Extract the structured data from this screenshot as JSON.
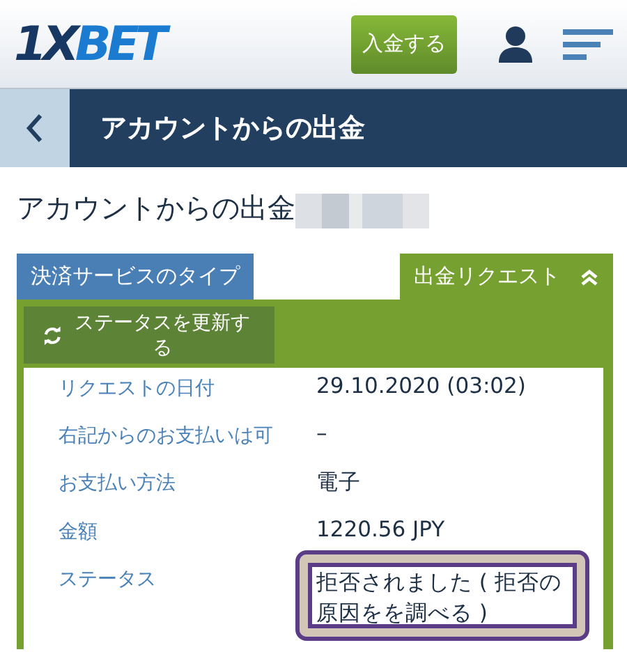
{
  "header": {
    "logo": {
      "prefix": "1X",
      "suffix": "BET"
    },
    "deposit_button": "入金する"
  },
  "nav": {
    "title": "アカウントからの出金"
  },
  "page_title": "アカウントからの出金",
  "tabs": [
    {
      "label": "決済サービスのタイプ",
      "selected": false
    },
    {
      "label": "出金リクエスト",
      "selected": true,
      "expanded": true
    }
  ],
  "refresh_button": "ステータスを更新する",
  "details": [
    {
      "label": "リクエストの日付",
      "value": "29.10.2020 (03:02)",
      "highlighted": false
    },
    {
      "label": "右記からのお支払いは可",
      "value": "–",
      "highlighted": false
    },
    {
      "label": "お支払い方法",
      "value": "電子",
      "highlighted": false
    },
    {
      "label": "金額",
      "value": "1220.56 JPY",
      "highlighted": false
    },
    {
      "label": "ステータス",
      "value": "拒否されました ( 拒否の原因をを調べる )",
      "highlighted": true
    }
  ]
}
